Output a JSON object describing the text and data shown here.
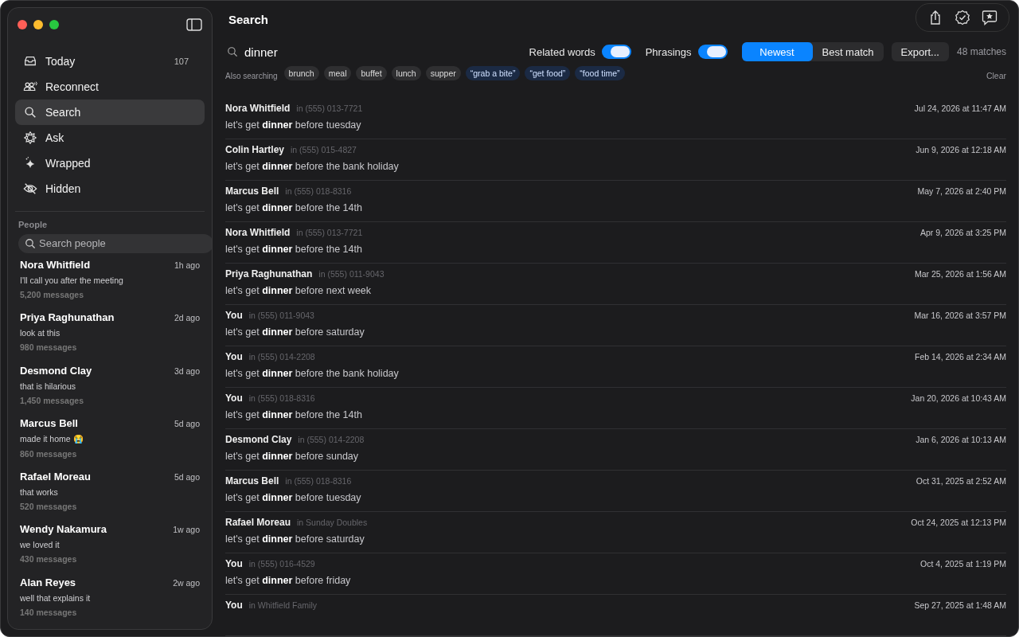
{
  "sidebar": {
    "nav": [
      {
        "label": "Today",
        "count": "107",
        "selected": false
      },
      {
        "label": "Reconnect",
        "selected": false
      },
      {
        "label": "Search",
        "selected": true
      },
      {
        "label": "Ask",
        "selected": false
      },
      {
        "label": "Wrapped",
        "selected": false
      },
      {
        "label": "Hidden",
        "selected": false
      }
    ],
    "people_heading": "People",
    "people_search": {
      "placeholder": "Search people"
    },
    "people": [
      {
        "name": "Nora Whitfield",
        "time": "1h ago",
        "preview": "I'll call you after the meeting",
        "count": "5,200 messages"
      },
      {
        "name": "Priya Raghunathan",
        "time": "2d ago",
        "preview": "look at this",
        "count": "980 messages"
      },
      {
        "name": "Desmond Clay",
        "time": "3d ago",
        "preview": "that is hilarious",
        "count": "1,450 messages"
      },
      {
        "name": "Marcus Bell",
        "time": "5d ago",
        "preview": "made it home 😭",
        "count": "860 messages"
      },
      {
        "name": "Rafael Moreau",
        "time": "5d ago",
        "preview": "that works",
        "count": "520 messages"
      },
      {
        "name": "Wendy Nakamura",
        "time": "1w ago",
        "preview": "we loved it",
        "count": "430 messages"
      },
      {
        "name": "Alan Reyes",
        "time": "2w ago",
        "preview": "well that explains it",
        "count": "140 messages"
      }
    ]
  },
  "main": {
    "title": "Search",
    "query": "dinner",
    "toggles": [
      {
        "label": "Related words",
        "on": true
      },
      {
        "label": "Phrasings",
        "on": true
      }
    ],
    "sort": [
      {
        "label": "Newest",
        "selected": true
      },
      {
        "label": "Best match",
        "selected": false
      }
    ],
    "export": "Export...",
    "match_count": "48 matches",
    "also_label": "Also searching",
    "chips": [
      {
        "label": "brunch",
        "kind": "word"
      },
      {
        "label": "meal",
        "kind": "word"
      },
      {
        "label": "buffet",
        "kind": "word"
      },
      {
        "label": "lunch",
        "kind": "word"
      },
      {
        "label": "supper",
        "kind": "word"
      },
      {
        "label": "“grab a bite”",
        "kind": "phrase"
      },
      {
        "label": "“get food”",
        "kind": "phrase"
      },
      {
        "label": "“food time”",
        "kind": "phrase"
      }
    ],
    "clear": "Clear",
    "results": [
      {
        "sender": "Nora Whitfield",
        "where": "in (555) 013-7721",
        "date": "Jul 24, 2026 at 11:47 AM",
        "text": "let's get **dinner** before tuesday"
      },
      {
        "sender": "Colin Hartley",
        "where": "in (555) 015-4827",
        "date": "Jun 9, 2026 at 12:18 AM",
        "text": "let's get **dinner** before the bank holiday"
      },
      {
        "sender": "Marcus Bell",
        "where": "in (555) 018-8316",
        "date": "May 7, 2026 at 2:40 PM",
        "text": "let's get **dinner** before the 14th"
      },
      {
        "sender": "Nora Whitfield",
        "where": "in (555) 013-7721",
        "date": "Apr 9, 2026 at 3:25 PM",
        "text": "let's get **dinner** before the 14th"
      },
      {
        "sender": "Priya Raghunathan",
        "where": "in (555) 011-9043",
        "date": "Mar 25, 2026 at 1:56 AM",
        "text": "let's get **dinner** before next week"
      },
      {
        "sender": "You",
        "where": "in (555) 011-9043",
        "date": "Mar 16, 2026 at 3:57 PM",
        "text": "let's get **dinner** before saturday"
      },
      {
        "sender": "You",
        "where": "in (555) 014-2208",
        "date": "Feb 14, 2026 at 2:34 AM",
        "text": "let's get **dinner** before the bank holiday"
      },
      {
        "sender": "You",
        "where": "in (555) 018-8316",
        "date": "Jan 20, 2026 at 10:43 AM",
        "text": "let's get **dinner** before the 14th"
      },
      {
        "sender": "Desmond Clay",
        "where": "in (555) 014-2208",
        "date": "Jan 6, 2026 at 10:13 AM",
        "text": "let's get **dinner** before sunday"
      },
      {
        "sender": "Marcus Bell",
        "where": "in (555) 018-8316",
        "date": "Oct 31, 2025 at 2:52 AM",
        "text": "let's get **dinner** before tuesday"
      },
      {
        "sender": "Rafael Moreau",
        "where": "in Sunday Doubles",
        "date": "Oct 24, 2025 at 12:13 PM",
        "text": "let's get **dinner** before saturday"
      },
      {
        "sender": "You",
        "where": "in (555) 016-4529",
        "date": "Oct 4, 2025 at 1:19 PM",
        "text": "let's get **dinner** before friday"
      },
      {
        "sender": "You",
        "where": "in Whitfield Family",
        "date": "Sep 27, 2025 at 1:48 AM"
      }
    ]
  }
}
